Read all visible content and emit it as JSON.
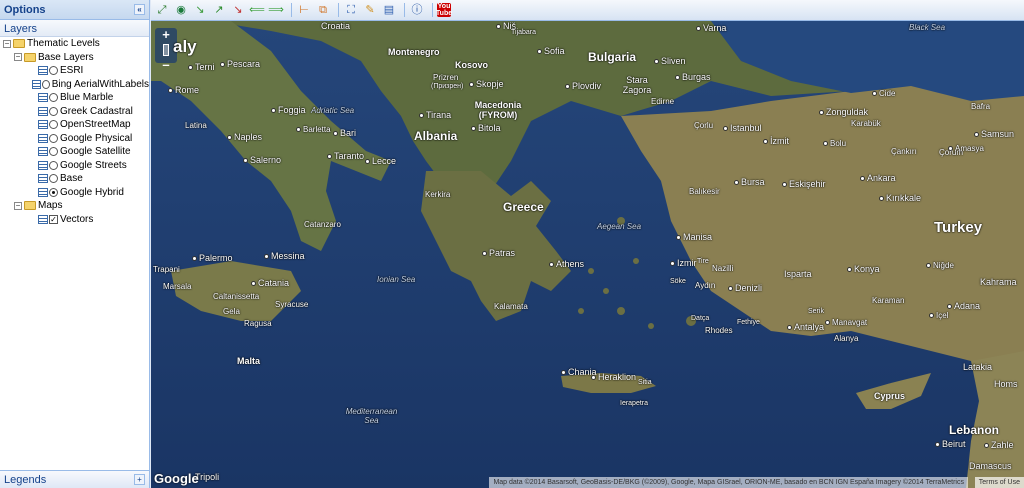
{
  "panel": {
    "title": "Options",
    "collapse": "«",
    "layers_header": "Layers",
    "legends_label": "Legends",
    "legends_expand": "+"
  },
  "tree": {
    "root": "Thematic Levels",
    "base_group": "Base Layers",
    "base_layers": [
      {
        "label": "ESRI",
        "selected": false
      },
      {
        "label": "Bing AerialWithLabels",
        "selected": false
      },
      {
        "label": "Blue Marble",
        "selected": false
      },
      {
        "label": "Greek Cadastral",
        "selected": false
      },
      {
        "label": "OpenStreetMap",
        "selected": false
      },
      {
        "label": "Google Physical",
        "selected": false
      },
      {
        "label": "Google Satellite",
        "selected": false
      },
      {
        "label": "Google Streets",
        "selected": false
      },
      {
        "label": "Base",
        "selected": false
      },
      {
        "label": "Google Hybrid",
        "selected": true
      }
    ],
    "maps_group": "Maps",
    "maps_layers": [
      {
        "label": "Vectors",
        "checked": true
      }
    ]
  },
  "toolbar": {
    "icons": [
      "zoom-extent-icon",
      "globe-icon",
      "zoom-in-icon",
      "zoom-out-icon",
      "back-icon",
      "forward-icon",
      "measure-line-icon",
      "measure-area-icon",
      "select-icon",
      "edit-icon",
      "print-icon",
      "info-icon",
      "youtube-icon"
    ],
    "youtube_text": "You Tube"
  },
  "map": {
    "zoom_in": "+",
    "zoom_out": "–",
    "google_logo": "Google",
    "attribution": "Map data ©2014 Basarsoft, GeoBasis-DE/BKG (©2009), Google, Mapa GISrael, ORION-ME, basado en BCN IGN España Imagery ©2014 TerraMetrics",
    "terms": "Terms of Use",
    "countries": [
      "aly",
      "Bulgaria",
      "Albania",
      "Greece",
      "Turkey",
      "Kosovo",
      "Montenegro",
      "Macedonia (FYROM)",
      "Malta",
      "Cyprus",
      "Lebanon"
    ],
    "cities": [
      "Croatia",
      "Niš",
      "Tijabara",
      "Sofia",
      "Sliven",
      "Varna",
      "Burgas",
      "Terni",
      "Pescara",
      "Rome",
      "Latina",
      "Foggia",
      "Barletta",
      "Bari",
      "Naples",
      "Salerno",
      "Taranto",
      "Lecce",
      "Prizren",
      "(Призрен)",
      "Skopje",
      "Plovdiv",
      "Stara Zagora",
      "Edirne",
      "Tirana",
      "Bitola",
      "Çorlu",
      "Istanbul",
      "İzmit",
      "Zonguldak",
      "Karabük",
      "Cide",
      "Bafra",
      "Samsun",
      "Bolu",
      "Çankırı",
      "Çorum",
      "Amasya",
      "Bursa",
      "Eskişehir",
      "Ankara",
      "Kırıkkale",
      "Balıkesir",
      "Kerkira",
      "Catanzaro",
      "Palermo",
      "Messina",
      "Trapani",
      "Marsala",
      "Catania",
      "Caltanissetta",
      "Gela",
      "Syracuse",
      "Ragusa",
      "Patras",
      "Athens",
      "Kalamata",
      "Manisa",
      "Izmir",
      "Tire",
      "Nazilli",
      "Söke",
      "Aydın",
      "Denizli",
      "Isparta",
      "Konya",
      "Niğde",
      "Kahrama",
      "Karaman",
      "Adana",
      "Içel",
      "Datça",
      "Rhodes",
      "Fethiye",
      "Antalya",
      "Serik",
      "Manavgat",
      "Alanya",
      "Chania",
      "Heraklion",
      "Sitia",
      "Ierapetra",
      "Latakia",
      "Homs",
      "Beirut",
      "Zahle",
      "Damascus",
      "Tripoli"
    ],
    "seas": [
      "Black Sea",
      "Adriatic Sea",
      "Ionian Sea",
      "Aegean Sea",
      "Mediterranean Sea"
    ]
  }
}
